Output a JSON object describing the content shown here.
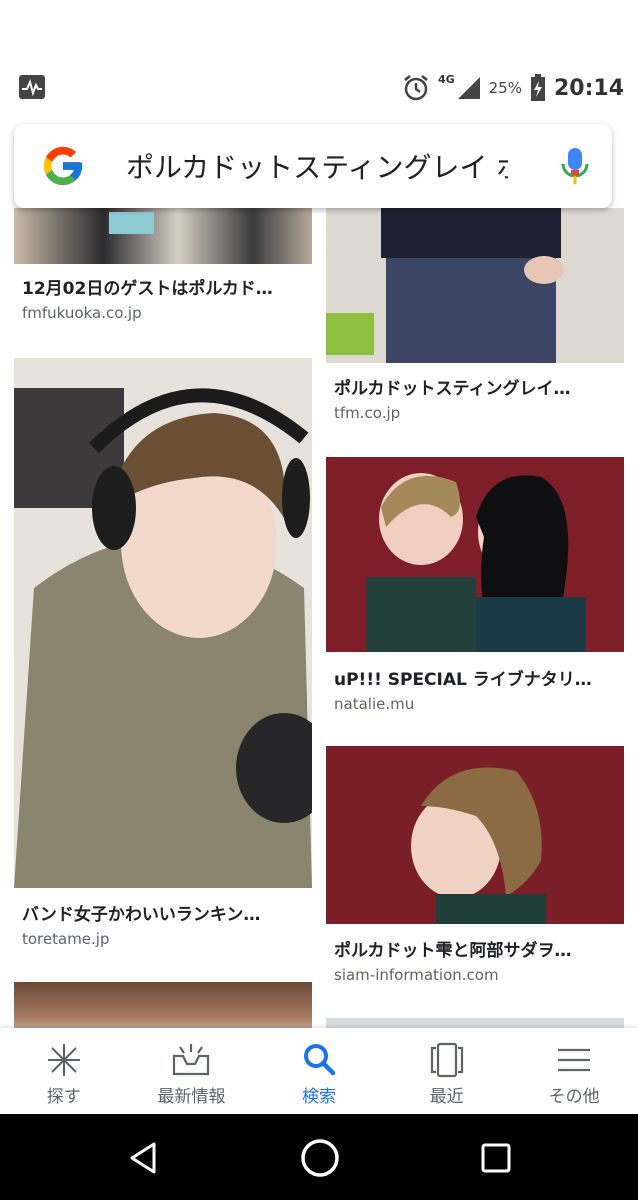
{
  "status_bar": {
    "network": "4G",
    "battery": "25%",
    "time": "20:14",
    "icons": [
      "activity-icon",
      "alarm-icon",
      "signal-icon",
      "battery-charging-icon"
    ]
  },
  "search": {
    "query": "ポルカドットスティングレイ ポ",
    "logo": "google-logo",
    "mic_icon": "mic-icon"
  },
  "results": {
    "left": [
      {
        "title": "12月02日のゲストはポルカド…",
        "source": "fmfukuoka.co.jp"
      },
      {
        "title": "バンド女子かわいいランキン…",
        "source": "toretame.jp"
      },
      {
        "title": "",
        "source": ""
      }
    ],
    "right": [
      {
        "title": "ポルカドットスティングレイ…",
        "source": "tfm.co.jp"
      },
      {
        "title": "uP!!! SPECIAL ライブナタリ…",
        "source": "natalie.mu"
      },
      {
        "title": "ポルカドット雫と阿部サダヲ…",
        "source": "siam-information.com"
      },
      {
        "title": "",
        "source": ""
      }
    ]
  },
  "bottom_nav": {
    "items": [
      {
        "label": "探す",
        "icon": "discover-asterisk-icon",
        "active": false
      },
      {
        "label": "最新情報",
        "icon": "updates-tray-icon",
        "active": false
      },
      {
        "label": "検索",
        "icon": "search-icon",
        "active": true
      },
      {
        "label": "最近",
        "icon": "recent-cards-icon",
        "active": false
      },
      {
        "label": "その他",
        "icon": "menu-icon",
        "active": false
      }
    ],
    "active_color": "#1a73e8",
    "inactive_color": "#5f6368"
  },
  "system_nav": [
    "back-icon",
    "home-icon",
    "overview-icon"
  ]
}
